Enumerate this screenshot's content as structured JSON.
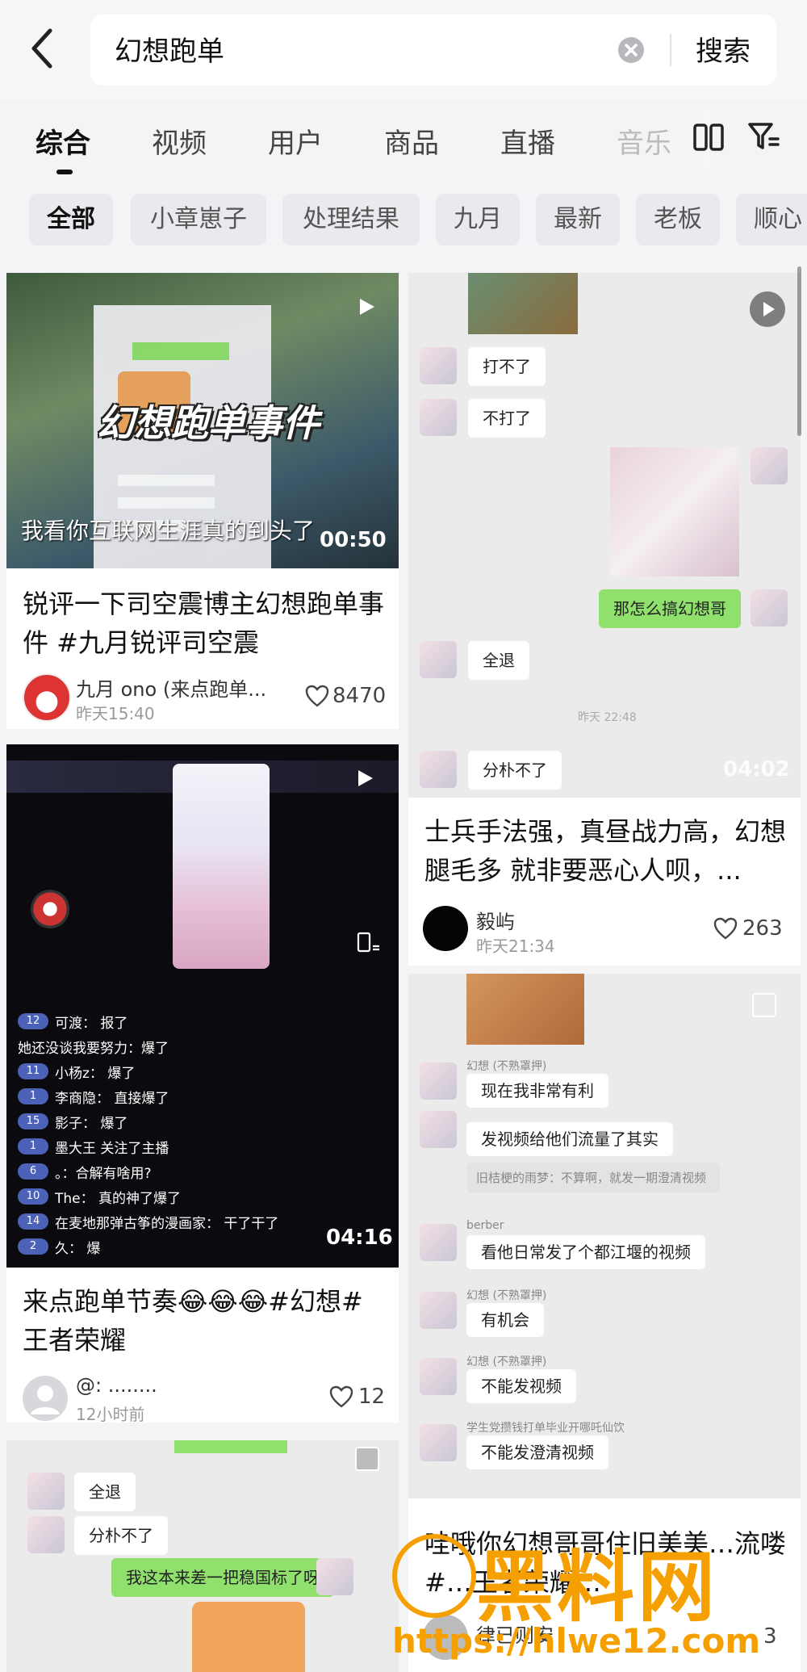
{
  "search": {
    "query": "幻想跑单",
    "button": "搜索"
  },
  "tabs": [
    "综合",
    "视频",
    "用户",
    "商品",
    "直播",
    "音乐"
  ],
  "chips": [
    "全部",
    "小章崽子",
    "处理结果",
    "九月",
    "最新",
    "老板",
    "顺心"
  ],
  "cards": [
    {
      "title": "锐评一下司空震博主幻想跑单事件 #九月锐评司空震",
      "overlay_title": "幻想跑单事件",
      "overlay_subtitle": "我看你互联网生涯真的到头了",
      "duration": "00:50",
      "author": "九月 ono (来点跑单...",
      "time": "昨天15:40",
      "likes": "8470"
    },
    {
      "title": "士兵手法强，真昼战力高，幻想腿毛多 就非要恶心人呗，...",
      "chat": [
        "打不了",
        "不打了",
        "那怎么搞幻想哥",
        "全退",
        "分朴不了"
      ],
      "chat_time": "昨天 22:48",
      "duration": "04:02",
      "author": "毅屿",
      "time": "昨天21:34",
      "likes": "263"
    },
    {
      "title": "来点跑单节奏😂😂😂#幻想#王者荣耀",
      "live_comments": [
        {
          "badge": "12",
          "text": "可渡： 报了"
        },
        {
          "badge": "",
          "text": "她还没谈我要努力：爆了"
        },
        {
          "badge": "11",
          "text": "小杨z： 爆了"
        },
        {
          "badge": "1",
          "text": "李商隐： 直接爆了"
        },
        {
          "badge": "15",
          "text": "影子： 爆了"
        },
        {
          "badge": "1",
          "text": "墨大王 关注了主播"
        },
        {
          "badge": "6",
          "text": "。：合解有啥用?"
        },
        {
          "badge": "10",
          "text": "The： 真的神了爆了"
        },
        {
          "badge": "14",
          "text": "在麦地那弹古筝的漫画家： 干了干了"
        },
        {
          "badge": "2",
          "text": "久： 爆"
        }
      ],
      "duration": "04:16",
      "author": "@: ........",
      "time": "12小时前",
      "likes": "12"
    },
    {
      "title": "哇哦你幻想哥哥住旧美美…流喽#…王者荣耀…",
      "chat": [
        {
          "name": "幻想 (不熟罩押)",
          "text": "现在我非常有利"
        },
        {
          "name": "",
          "text": "发视频给他们流量了其实"
        },
        {
          "name": "",
          "text": "旧桔梗的雨梦：不算啊，就发一期澄清视频"
        },
        {
          "name": "berber",
          "text": "看他日常发了个都江堰的视频"
        },
        {
          "name": "幻想 (不熟罩押)",
          "text": "有机会"
        },
        {
          "name": "幻想 (不熟罩押)",
          "text": "不能发视频"
        },
        {
          "name": "学生党攒钱打单毕业开哪吒仙饮",
          "text": "不能发澄清视频"
        }
      ],
      "author": "律已则安",
      "likes": "3"
    },
    {
      "chat": [
        "全退",
        "分朴不了",
        "我这本来差一把稳国标了呀"
      ]
    }
  ],
  "watermark": {
    "text": "黑料网",
    "url": "https://hlwe12.com"
  }
}
